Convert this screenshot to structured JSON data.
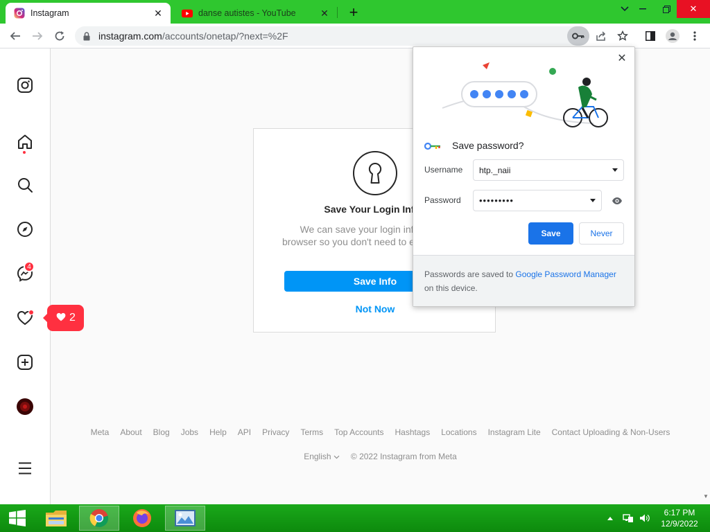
{
  "browser": {
    "tabs": [
      {
        "title": "Instagram",
        "active": true,
        "icon": "instagram-icon"
      },
      {
        "title": "danse autistes - YouTube",
        "active": false,
        "icon": "youtube-icon"
      }
    ],
    "url_host": "instagram.com",
    "url_path": "/accounts/onetap/?next=%2F"
  },
  "sidebar": {
    "messages_badge": "4"
  },
  "notification_popup": {
    "count": "2"
  },
  "card": {
    "heading": "Save Your Login Info?",
    "description": "We can save your login info on this browser so you don't need to enter it again.",
    "save_label": "Save Info",
    "not_now_label": "Not Now"
  },
  "footer": {
    "links": [
      "Meta",
      "About",
      "Blog",
      "Jobs",
      "Help",
      "API",
      "Privacy",
      "Terms",
      "Top Accounts",
      "Hashtags",
      "Locations",
      "Instagram Lite",
      "Contact Uploading & Non-Users"
    ],
    "language": "English",
    "copyright": "© 2022 Instagram from Meta"
  },
  "password_popup": {
    "title": "Save password?",
    "username_label": "Username",
    "username_value": "htp._naii",
    "password_label": "Password",
    "password_value": "•••••••••",
    "save_label": "Save",
    "never_label": "Never",
    "footer_prefix": "Passwords are saved to ",
    "footer_link": "Google Password Manager",
    "footer_suffix": " on this device."
  },
  "taskbar": {
    "time": "6:17 PM",
    "date": "12/9/2022"
  },
  "colors": {
    "titlebar": "#2fc72f",
    "instagram_blue": "#0095f6",
    "google_blue": "#1a73e8",
    "notification_red": "#ff3040"
  }
}
